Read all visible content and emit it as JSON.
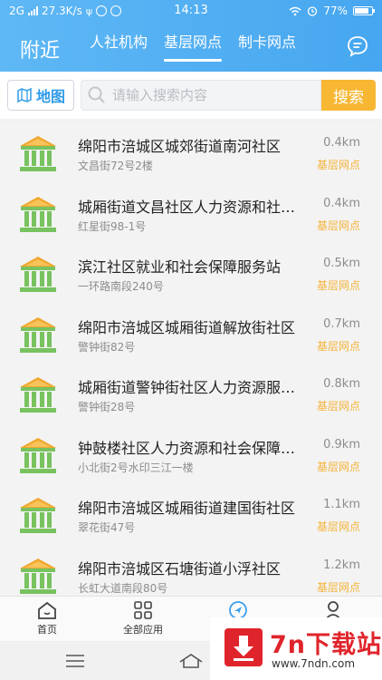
{
  "status_bar": {
    "network": "2G",
    "speed": "27.3K/s",
    "time": "14:13",
    "battery": "77%"
  },
  "header": {
    "title": "附近",
    "tabs": [
      {
        "label": "人社机构",
        "active": false
      },
      {
        "label": "基层网点",
        "active": true
      },
      {
        "label": "制卡网点",
        "active": false
      }
    ],
    "message_icon": "chat-bubble-icon"
  },
  "search": {
    "map_label": "地图",
    "placeholder": "请输入搜索内容",
    "button_label": "搜索"
  },
  "list": {
    "items": [
      {
        "name": "绵阳市涪城区城郊街道南河社区",
        "address": "文昌街72号2楼",
        "distance": "0.4km",
        "type": "基层网点"
      },
      {
        "name": "城厢街道文昌社区人力资源和社会保障服务站",
        "address": "红星街98-1号",
        "distance": "0.4km",
        "type": "基层网点"
      },
      {
        "name": "滨江社区就业和社会保障服务站",
        "address": "一环路南段240号",
        "distance": "0.5km",
        "type": "基层网点"
      },
      {
        "name": "绵阳市涪城区城厢街道解放街社区",
        "address": "警钟街82号",
        "distance": "0.7km",
        "type": "基层网点"
      },
      {
        "name": "城厢街道警钟街社区人力资源服务站",
        "address": "警钟街28号",
        "distance": "0.8km",
        "type": "基层网点"
      },
      {
        "name": "钟鼓楼社区人力资源和社会保障服务站",
        "address": "小北街2号水印三江一楼",
        "distance": "0.9km",
        "type": "基层网点"
      },
      {
        "name": "绵阳市涪城区城厢街道建国街社区",
        "address": "翠花街47号",
        "distance": "1.1km",
        "type": "基层网点"
      },
      {
        "name": "绵阳市涪城区石塘街道小浮社区",
        "address": "长虹大道南段80号",
        "distance": "1.2km",
        "type": "基层网点"
      }
    ]
  },
  "bottom_nav": {
    "home_label": "首页",
    "apps_label": "全部应用"
  },
  "watermark": {
    "title": "7n下载站",
    "url": "www.7ndn.com"
  },
  "colors": {
    "header": "#4aa8f0",
    "accent_orange": "#f7b733",
    "icon_green": "#6fbf5a"
  }
}
